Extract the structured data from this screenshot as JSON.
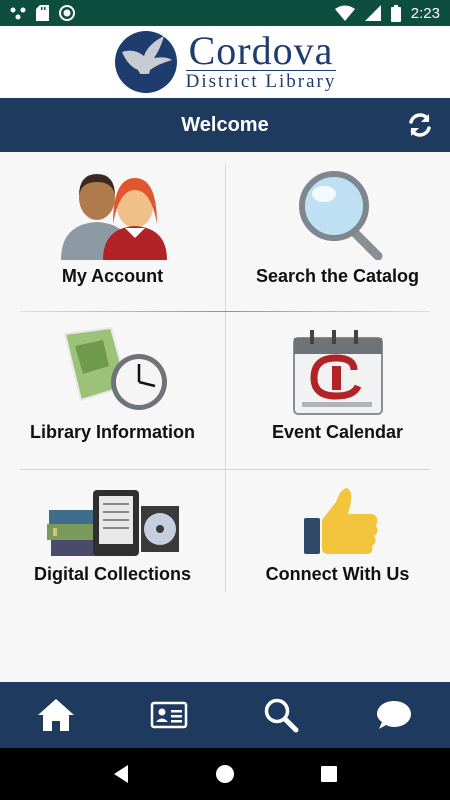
{
  "status_bar": {
    "time": "2:23"
  },
  "logo": {
    "title": "Cordova",
    "subtitle": "District Library"
  },
  "header": {
    "title": "Welcome"
  },
  "tiles": [
    {
      "label": "My Account",
      "icon": "people-icon"
    },
    {
      "label": "Search the Catalog",
      "icon": "magnifier-icon"
    },
    {
      "label": "Library Information",
      "icon": "map-clock-icon"
    },
    {
      "label": "Event Calendar",
      "icon": "calendar-icon"
    },
    {
      "label": "Digital Collections",
      "icon": "books-ereader-disc-icon"
    },
    {
      "label": "Connect With Us",
      "icon": "thumbs-up-icon"
    }
  ],
  "bottom_nav": [
    "home-icon",
    "library-card-icon",
    "search-icon",
    "chat-icon"
  ],
  "colors": {
    "status_bar": "#0d4e3e",
    "brand_navy": "#1e3a5f",
    "logo_text": "#1e3c6e"
  }
}
